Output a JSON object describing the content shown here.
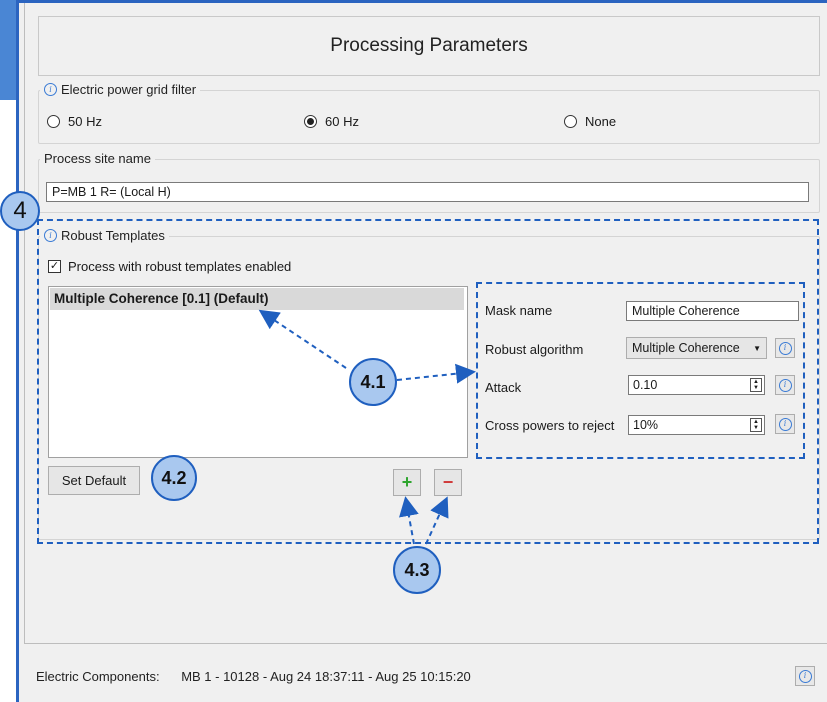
{
  "title": "Processing Parameters",
  "power_filter": {
    "label": "Electric power grid filter",
    "options": [
      "50 Hz",
      "60 Hz",
      "None"
    ],
    "selected": "60 Hz"
  },
  "process_site": {
    "label": "Process site name",
    "value": "P=MB 1 R= (Local H)"
  },
  "robust": {
    "label": "Robust Templates",
    "checkbox_label": "Process with robust templates enabled",
    "checked": true,
    "templates": [
      "Multiple Coherence [0.1] (Default)"
    ],
    "set_default_label": "Set Default",
    "add_label": "+",
    "remove_label": "−"
  },
  "params": {
    "mask_name_label": "Mask name",
    "mask_name_value": "Multiple Coherence",
    "algorithm_label": "Robust algorithm",
    "algorithm_value": "Multiple Coherence",
    "attack_label": "Attack",
    "attack_value": "0.10",
    "cross_label": "Cross powers to reject",
    "cross_value": "10%"
  },
  "status": {
    "label": "Electric Components:",
    "value": "MB 1 - 10128 - Aug 24 18:37:11 - Aug 25 10:15:20"
  },
  "callouts": {
    "c4": "4",
    "c41": "4.1",
    "c42": "4.2",
    "c43": "4.3"
  },
  "colors": {
    "annotation_blue": "#1f5fbf",
    "callout_fill": "#a9c8ef",
    "add_green": "#2fa52f",
    "remove_red": "#d03a3a"
  }
}
